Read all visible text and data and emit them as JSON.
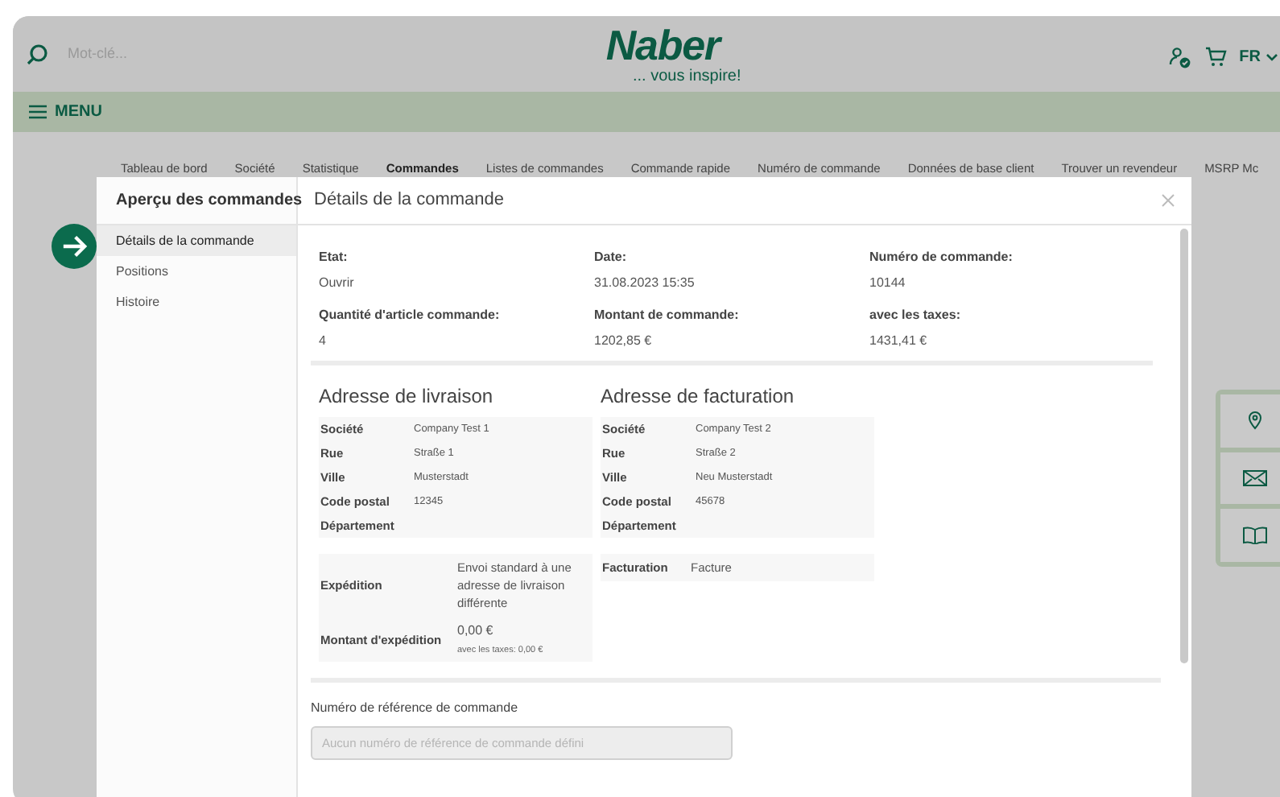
{
  "header": {
    "search_placeholder": "Mot-clé...",
    "logo": "Naber",
    "tagline": "... vous inspire!",
    "language": "FR"
  },
  "menu": {
    "label": "MENU"
  },
  "nav_tabs": [
    {
      "label": "Tableau de bord",
      "selected": false
    },
    {
      "label": "Société",
      "selected": false
    },
    {
      "label": "Statistique",
      "selected": false
    },
    {
      "label": "Commandes",
      "selected": true
    },
    {
      "label": "Listes de commandes",
      "selected": false
    },
    {
      "label": "Commande rapide",
      "selected": false
    },
    {
      "label": "Numéro de commande",
      "selected": false
    },
    {
      "label": "Données de base client",
      "selected": false
    },
    {
      "label": "Trouver un revendeur",
      "selected": false
    },
    {
      "label": "MSRP Mc",
      "selected": false
    }
  ],
  "modal": {
    "sidebar_title": "Aperçu des commandes",
    "title": "Détails de la commande",
    "sidebar_items": [
      {
        "label": "Détails de la commande",
        "selected": true
      },
      {
        "label": "Positions",
        "selected": false
      },
      {
        "label": "Histoire",
        "selected": false
      }
    ],
    "info": [
      {
        "label": "Etat:",
        "value": "Ouvrir"
      },
      {
        "label": "Date:",
        "value": "31.08.2023 15:35"
      },
      {
        "label": "Numéro de commande:",
        "value": "10144"
      },
      {
        "label": "Quantité d'article commande:",
        "value": "4"
      },
      {
        "label": "Montant de commande:",
        "value": "1202,85 €"
      },
      {
        "label": "avec les taxes:",
        "value": "1431,41 €"
      }
    ],
    "addresses": [
      {
        "title": "Adresse de livraison",
        "rows": [
          {
            "label": "Société",
            "value": "Company Test 1"
          },
          {
            "label": "Rue",
            "value": "Straße 1"
          },
          {
            "label": "Ville",
            "value": "Musterstadt"
          },
          {
            "label": "Code postal",
            "value": "12345"
          },
          {
            "label": "Département"
          }
        ]
      },
      {
        "title": "Adresse de facturation",
        "rows": [
          {
            "label": "Société",
            "value": "Company Test 2"
          },
          {
            "label": "Rue",
            "value": "Straße 2"
          },
          {
            "label": "Ville",
            "value": "Neu Musterstadt"
          },
          {
            "label": "Code postal",
            "value": "45678"
          },
          {
            "label": "Département"
          }
        ]
      }
    ],
    "shipping": [
      {
        "label": "Expédition",
        "value": "Envoi standard à une adresse de livraison différente"
      },
      {
        "label": "Montant d'expédition",
        "value": "0,00 €",
        "note": "avec les taxes: 0,00 €"
      }
    ],
    "billing": [
      {
        "label": "Facturation",
        "value": "Facture"
      }
    ],
    "reference": {
      "label": "Numéro de référence de commande",
      "placeholder": "Aucun numéro de référence de commande défini"
    }
  }
}
